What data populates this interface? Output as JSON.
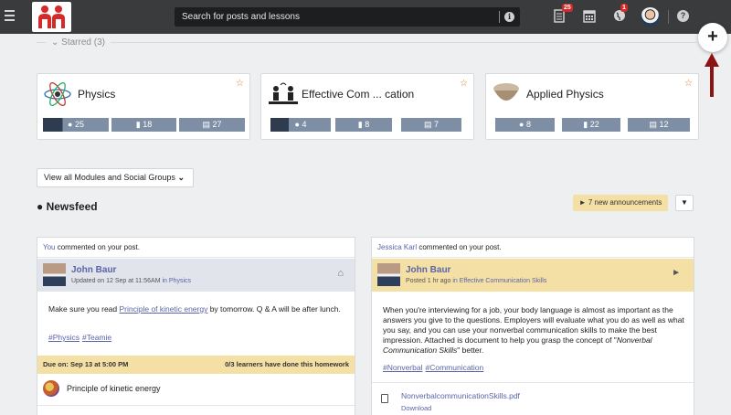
{
  "topbar": {
    "search_placeholder": "Search for posts and lessons",
    "notifications_count": "25",
    "globe_count": "1"
  },
  "starred": {
    "label": "Starred (3)"
  },
  "modules": [
    {
      "title": "Physics",
      "comments": "25",
      "lessons": "18",
      "calendar": "27"
    },
    {
      "title": "Effective Com ... cation",
      "comments": "4",
      "lessons": "8",
      "calendar": "7"
    },
    {
      "title": "Applied Physics",
      "comments": "8",
      "lessons": "22",
      "calendar": "12"
    }
  ],
  "view_all": {
    "label": "View all Modules and Social Groups"
  },
  "newsfeed": {
    "title": "Newsfeed",
    "announcements": "7 new announcements"
  },
  "posts": [
    {
      "head_actor": "You",
      "head_text": " commented on your post.",
      "author": "John Baur",
      "meta_prefix": "Updated on 12 Sep at 11:56AM ",
      "meta_link": "in Physics",
      "body_1": "Make sure you read ",
      "body_link": "Principle of kinetic energy",
      "body_2": "  by tomorrow. Q & A will be after lunch.",
      "tags": [
        "#Physics",
        "#Teamie"
      ],
      "due": "Due on: Sep 13 at 5:00 PM",
      "learners": "0/3 learners have done this homework",
      "attachment": "Principle of kinetic energy"
    },
    {
      "head_actor": "Jessica Karl",
      "head_text": " commented on your post.",
      "author": "John Baur",
      "meta_prefix": "Posted 1 hr ago ",
      "meta_link": "in Effective Communication Skills",
      "body_1": "When you're interviewing for a job, your body language is almost as important as the answers you give to the questions. Employers will evaluate what you do as well as what you say, and you can use your nonverbal communication skills to make the best impression. Attached is document to help you grasp the concept of \"",
      "body_em": "Nonverbal Communication Skills",
      "body_2": "\" better.",
      "tags": [
        "#Nonverbal",
        "#Communication"
      ],
      "file_name": "NonverbalcommunicationSkills.pdf",
      "file_action": "Download"
    }
  ],
  "colors": {
    "topbar": "#393b3d",
    "stat": "#7e8ea4",
    "highlight": "#f4e0a5",
    "link": "#5a64a8",
    "arrow": "#8b1313"
  }
}
